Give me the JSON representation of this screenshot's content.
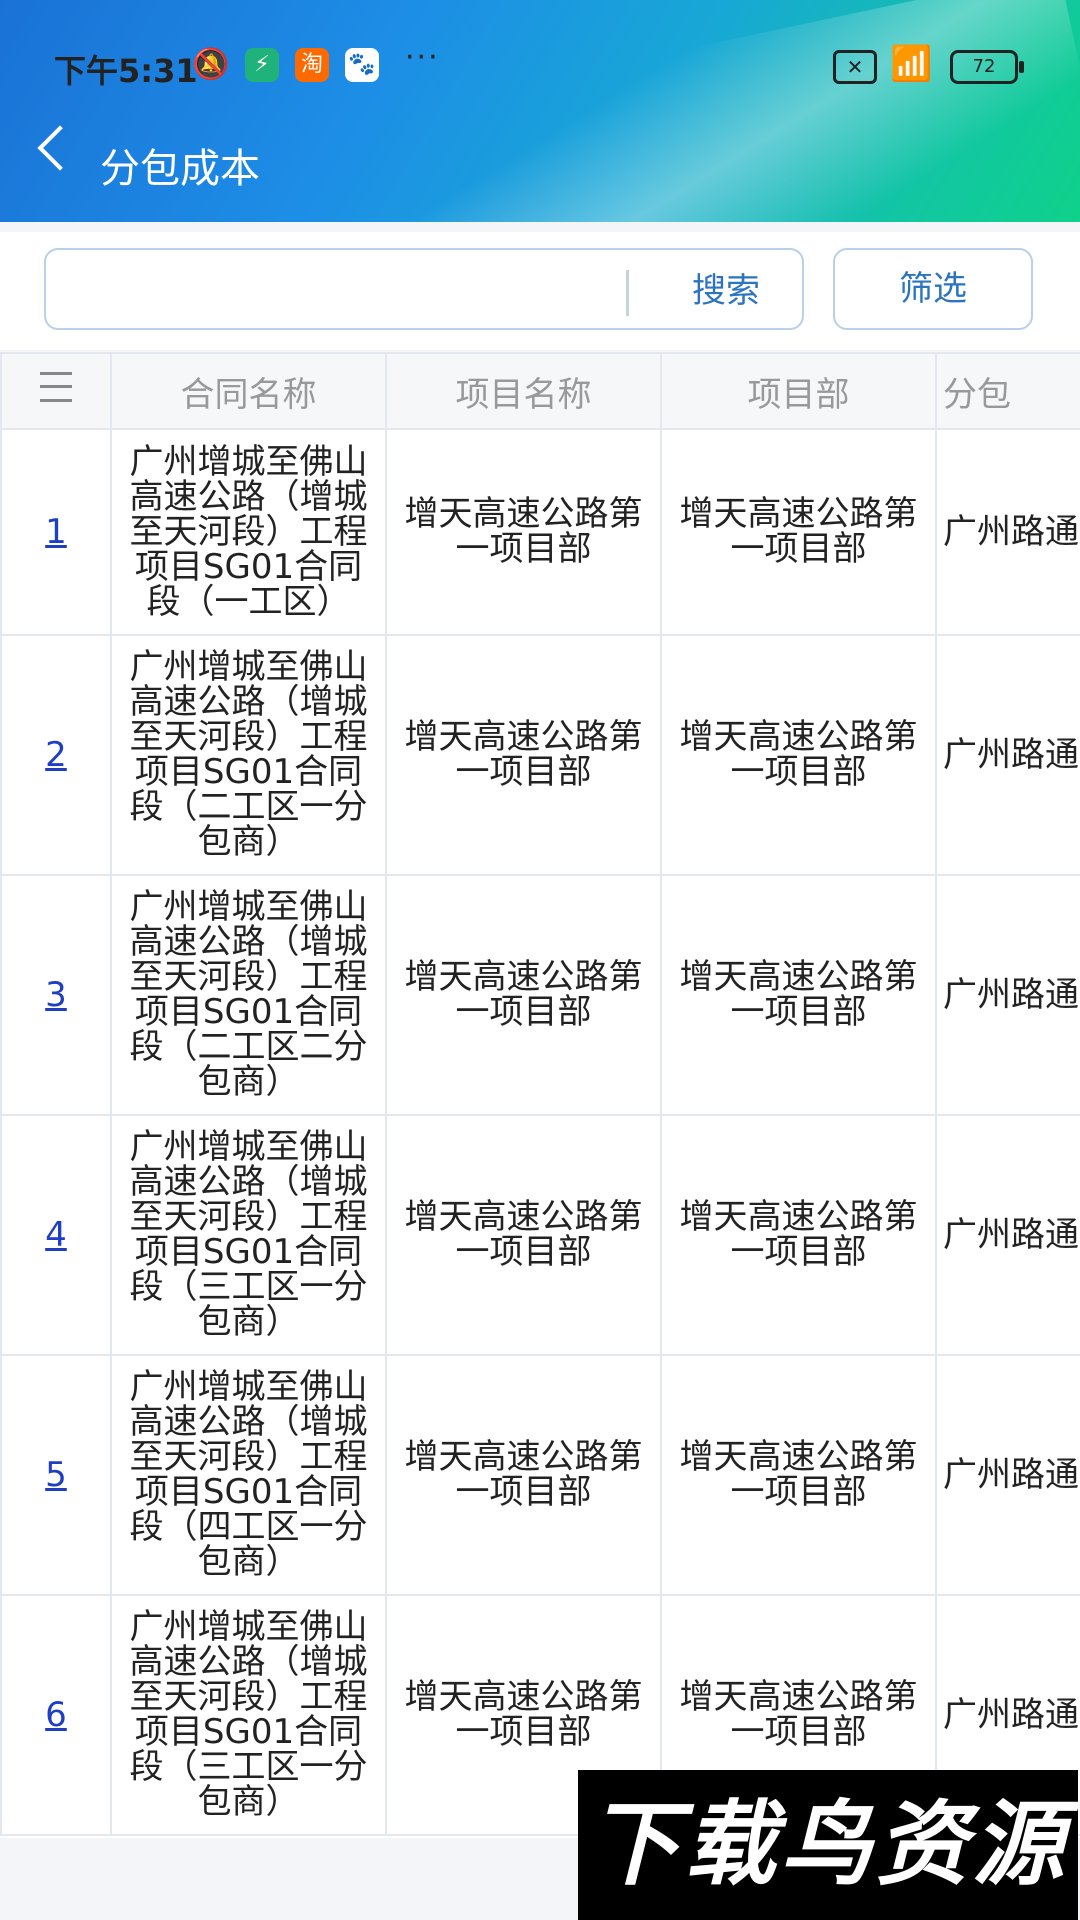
{
  "status_bar": {
    "time": "下午5:31",
    "battery": "72"
  },
  "header": {
    "title": "分包成本"
  },
  "search": {
    "placeholder": "",
    "search_label": "搜索",
    "filter_label": "筛选"
  },
  "table": {
    "columns": [
      "合同名称",
      "项目名称",
      "项目部",
      "分包"
    ],
    "rows": [
      {
        "idx": "1",
        "contract": "广州增城至佛山高速公路（增城至天河段）工程项目SG01合同段（一工区）",
        "project": "增天高速公路第一项目部",
        "dept": "增天高速公路第一项目部",
        "sub": "广州路通程有限"
      },
      {
        "idx": "2",
        "contract": "广州增城至佛山高速公路（增城至天河段）工程项目SG01合同段（二工区一分包商）",
        "project": "增天高速公路第一项目部",
        "dept": "增天高速公路第一项目部",
        "sub": "广州路通程有限"
      },
      {
        "idx": "3",
        "contract": "广州增城至佛山高速公路（增城至天河段）工程项目SG01合同段（二工区二分包商）",
        "project": "增天高速公路第一项目部",
        "dept": "增天高速公路第一项目部",
        "sub": "广州路通程有限"
      },
      {
        "idx": "4",
        "contract": "广州增城至佛山高速公路（增城至天河段）工程项目SG01合同段（三工区一分包商）",
        "project": "增天高速公路第一项目部",
        "dept": "增天高速公路第一项目部",
        "sub": "广州路通程有限"
      },
      {
        "idx": "5",
        "contract": "广州增城至佛山高速公路（增城至天河段）工程项目SG01合同段（四工区一分包商）",
        "project": "增天高速公路第一项目部",
        "dept": "增天高速公路第一项目部",
        "sub": "广州路通程有限"
      },
      {
        "idx": "6",
        "contract": "广州增城至佛山高速公路（增城至天河段）工程项目SG01合同段（三工区一分包商）",
        "project": "增天高速公路第一项目部",
        "dept": "增天高速公路第一项目部",
        "sub": "广州路通程有限"
      }
    ]
  },
  "watermark": {
    "text": "下载鸟资源"
  }
}
